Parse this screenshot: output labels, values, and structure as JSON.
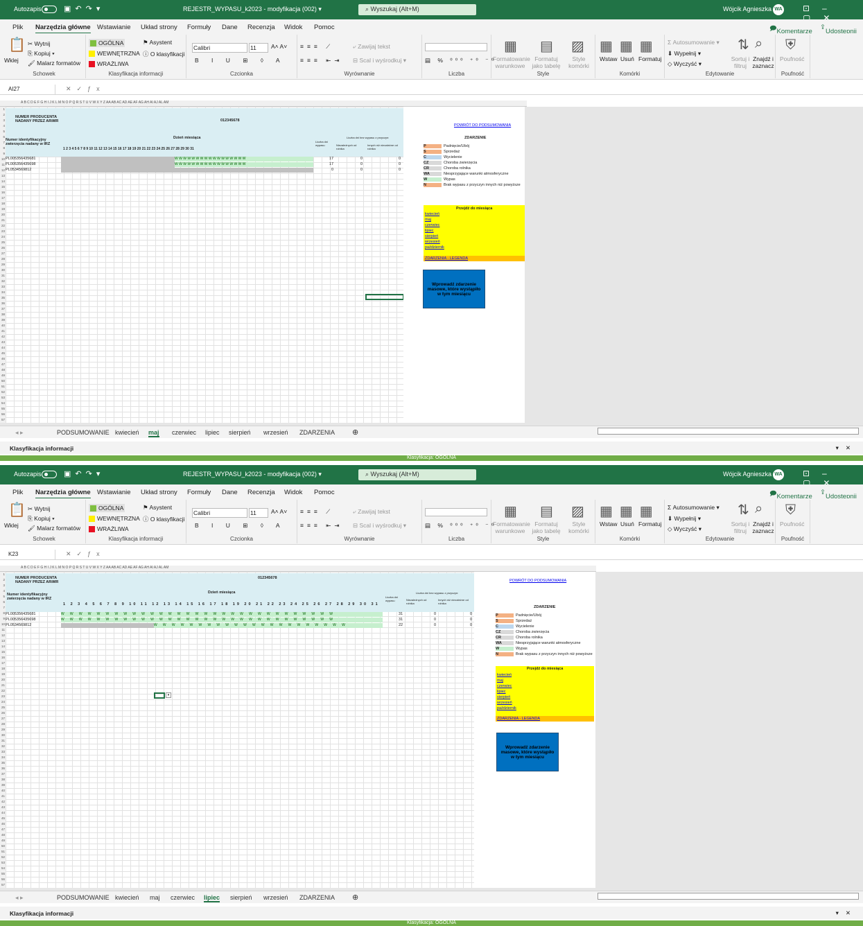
{
  "windows": [
    {
      "title": {
        "autosave": "Autozapis",
        "doc": "REJESTR_WYPASU_k2023 - modyfikacja (002) ▾",
        "search": "Wyszukaj (Alt+M)",
        "user": "Wójcik Agnieszka",
        "avatar": "WA"
      },
      "menu": [
        "Plik",
        "Narzędzia główne",
        "Wstawianie",
        "Układ strony",
        "Formuły",
        "Dane",
        "Recenzja",
        "Widok",
        "Pomoc"
      ],
      "menu_right": {
        "comments": "Komentarze",
        "share": "Udostępnij"
      },
      "ribbon": {
        "wklej": "Wklej",
        "wytnij": "Wytnij",
        "kopiuj": "Kopiuj",
        "malarz": "Malarz formatów",
        "schowek": "Schowek",
        "ogolna": "OGÓLNA",
        "wewnetrzna": "WEWNĘTRZNA",
        "wrazliwa": "WRAŻLIWA",
        "asystent": "Asystent",
        "oklas": "O klasyfikacji",
        "klasyfikacja": "Klasyfikacja informacji",
        "font": "Calibri",
        "size": "11",
        "czcionka": "Czcionka",
        "zawijaj": "Zawijaj tekst",
        "scal": "Scal i wyśrodkuj",
        "wyrownanie": "Wyrównanie",
        "liczba": "Liczba",
        "formwar": "Formatowanie warunkowe",
        "formtab": "Formatuj jako tabelę",
        "style_kom": "Style komórki",
        "style": "Style",
        "wstaw": "Wstaw",
        "usun": "Usuń",
        "formatuj": "Formatuj",
        "komorki": "Komórki",
        "autosum": "Autosumowanie",
        "wypelnij": "Wypełnij",
        "wyczysc": "Wyczyść",
        "sortuj": "Sortuj i filtruj",
        "znajdz": "Znajdź i zaznacz",
        "edytowanie": "Edytowanie",
        "poufnosc": "Poufność"
      },
      "namebox": "AI27",
      "col_letters": "A        B C D E F G H I J K L M N O P Q R S T U V W X Y Z AA AB AC AD AE AF    AG       AH       AI       AJ  AL         AM",
      "sheet": {
        "producer_label": "NUMER PRODUCENTA NADANY PRZEZ ARiMR",
        "producer_num": "012345678",
        "day_header": "Dzień miesiąca",
        "id_header": "Numer identyfikacyjny zwierzęcia nadany w IRZ",
        "days": "1  2  3  4  5  6  7  8  9 10 11 12 13 14 15 16 17 18 19 20 21 22 23 24 25 26 27 28 29 30 31",
        "liczba_dni": "Liczba dni wypasu",
        "bez_wypasu": "Liczba dni bez wypasu z przyczyn:",
        "niezal": "Niezależnych od rolnika",
        "innych": "Innych niż niezależne od rolnika",
        "ids": [
          "PL005356435681",
          "PL005356435698",
          "PL0534569812"
        ],
        "w_row1": "W  W  W  W  W  W  W  W  W  W  W  W  W  W  W  W  W",
        "w_row2": "W  W  W  W  W  W  W  W  W  W  W  W  W  W  W  W  W",
        "vals": [
          [
            "17",
            "0",
            "0"
          ],
          [
            "17",
            "0",
            "0"
          ],
          [
            "0",
            "0",
            "0"
          ]
        ]
      },
      "tabs": [
        "PODSUMOWANIE",
        "kwiecień",
        "maj",
        "czerwiec",
        "lipiec",
        "sierpień",
        "wrzesień",
        "ZDARZENIA"
      ],
      "active_tab": "maj",
      "klasyfikacja": "Klasyfikacja informacji",
      "status": "Klasyfikacja: OGÓLNA"
    },
    {
      "namebox": "K23",
      "col_letters": "A        B C D E F G H I J K L M N O P Q R S T U V W X Y Z AA AB AC AD AE AF    AG       AH       AI       AJ  AL         AM",
      "sheet": {
        "w_full": "W  W  W  W  W  W  W  W  W  W  W  W  W  W  W  W  W  W  W  W  W  W  W  W  W  W  W  W  W  W  W",
        "w_part": "W  W  W  W  W  W  W  W  W  W  W  W  W  W  W  W  W  W  W  W  W  W",
        "vals": [
          [
            "31",
            "0",
            "0"
          ],
          [
            "31",
            "0",
            "0"
          ],
          [
            "22",
            "0",
            "0"
          ]
        ]
      },
      "active_tab": "lipiec",
      "status": "Klasyfikacja: OGÓLNA"
    }
  ],
  "panel": {
    "back": "POWRÓT DO PODSUMOWANIA",
    "zdarzenie": "ZDARZENIE",
    "codes": [
      [
        "P",
        "Padnięcie/Ubój"
      ],
      [
        "S",
        "Sprzedaż"
      ],
      [
        "C",
        "Wycielenie"
      ],
      [
        "CZ",
        "Choroba zwierzęcia"
      ],
      [
        "CR",
        "Choroba rolnika"
      ],
      [
        "WA",
        "Niesprzyjające warunki atmosferyczne"
      ],
      [
        "W",
        "Wypas"
      ],
      [
        "N",
        "Brak wypasu z przyczyn innych niż powyższe"
      ]
    ],
    "przejdz": "Przejdź do miesiąca",
    "months": [
      "kwiecień",
      "maj",
      "czerwiec",
      "lipiec",
      "sierpień",
      "wrzesień",
      "październik"
    ],
    "legend_link": "ZDARZENIA - LEGENDA",
    "mass": "Wprowadź zdarzenie masowe, które wystąpiło w tym miesiącu"
  }
}
